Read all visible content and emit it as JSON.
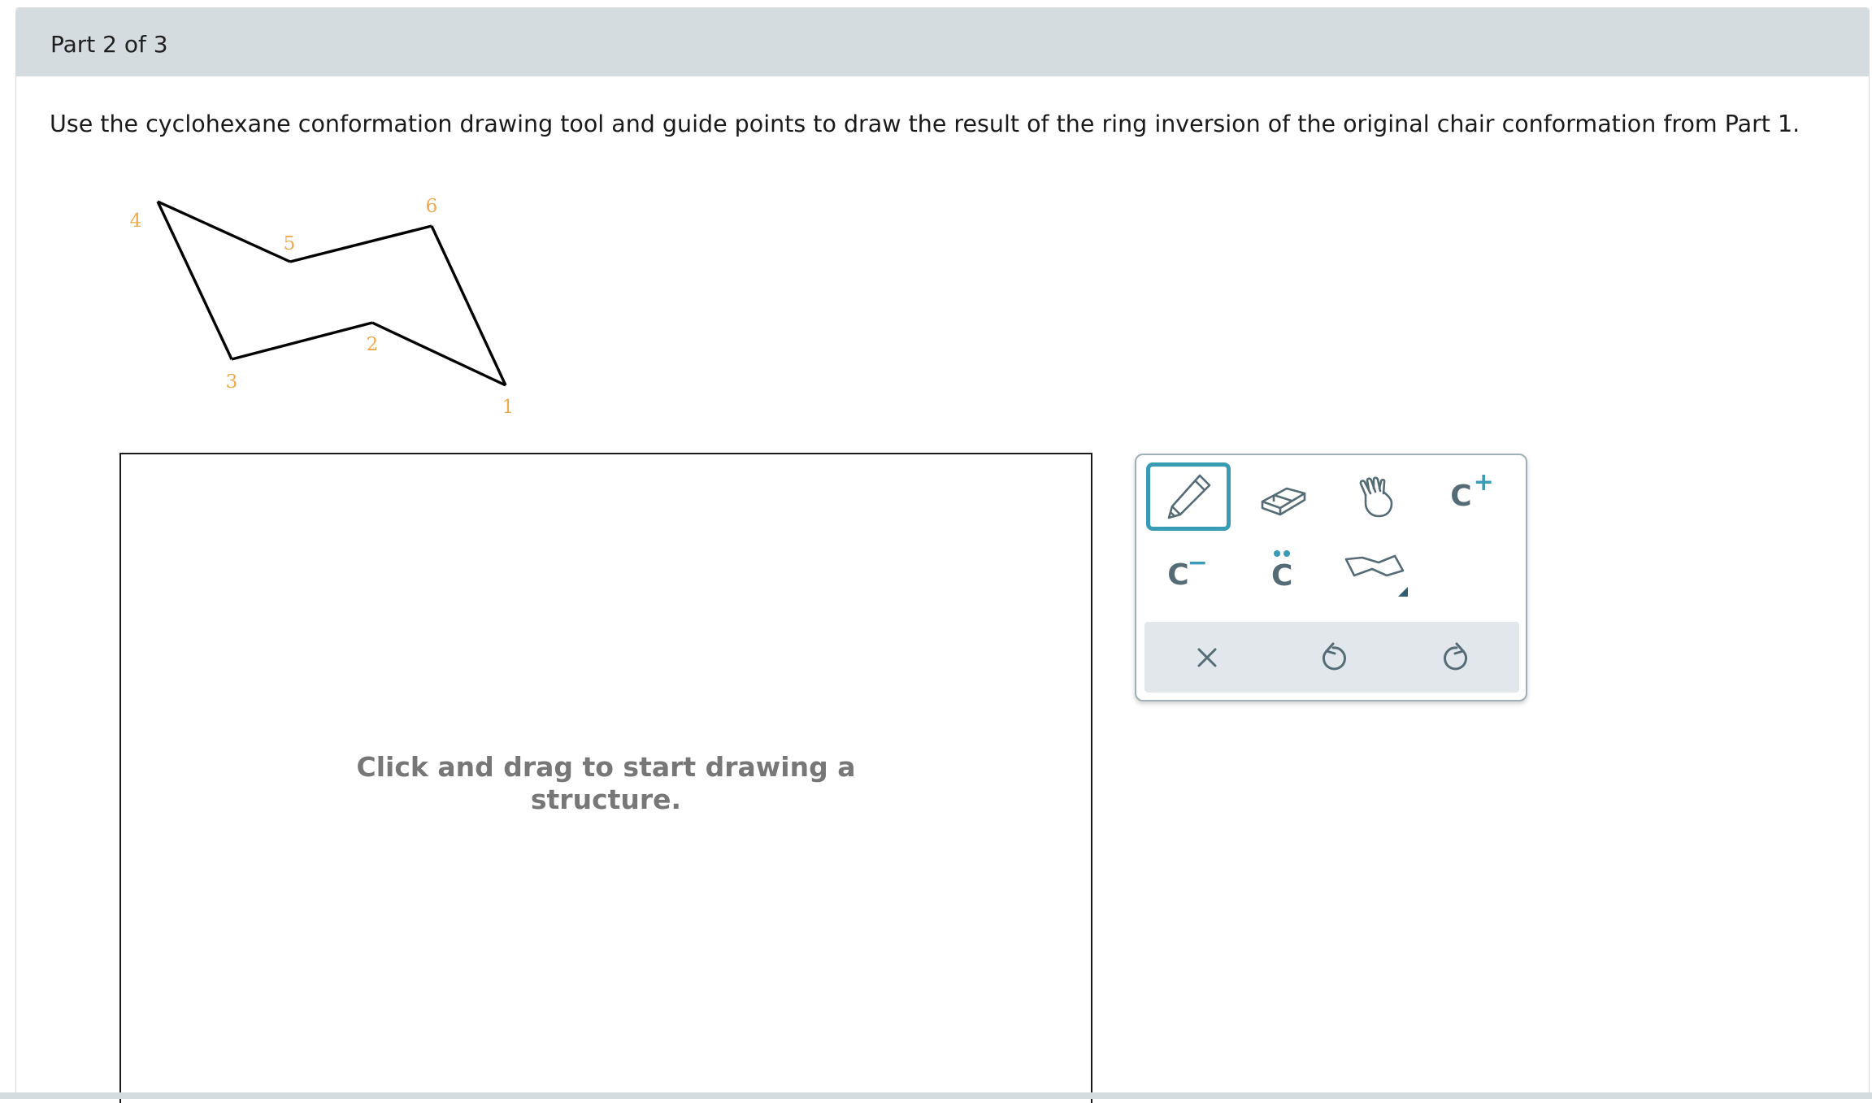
{
  "header": {
    "part_label": "Part 2 of 3"
  },
  "instruction": "Use the cyclohexane conformation drawing tool and guide points to draw the result of the ring inversion of the original chair conformation from Part 1.",
  "reference_structure": {
    "atom_labels": [
      "1",
      "2",
      "3",
      "4",
      "5",
      "6"
    ],
    "bond_color": "#000000",
    "label_color": "#f0a94d"
  },
  "canvas": {
    "hint_line1": "Click and drag to start drawing a",
    "hint_line2": "structure."
  },
  "toolbox": {
    "tools": [
      {
        "name": "pencil",
        "icon": "pencil-icon",
        "selected": true
      },
      {
        "name": "eraser",
        "icon": "eraser-icon",
        "selected": false
      },
      {
        "name": "move",
        "icon": "hand-icon",
        "selected": false
      },
      {
        "name": "cation",
        "label": "C",
        "superscript": "+"
      },
      {
        "name": "anion",
        "label": "C",
        "superscript": "−"
      },
      {
        "name": "lone-pair",
        "label": "C",
        "dots": ":"
      },
      {
        "name": "chair-template",
        "icon": "cyclohexane-chair-icon"
      }
    ],
    "actions": [
      {
        "name": "clear",
        "icon": "x-icon"
      },
      {
        "name": "undo",
        "icon": "undo-icon"
      },
      {
        "name": "redo",
        "icon": "redo-icon"
      }
    ],
    "accent_color": "#3a9bb5",
    "icon_color": "#556b75"
  }
}
